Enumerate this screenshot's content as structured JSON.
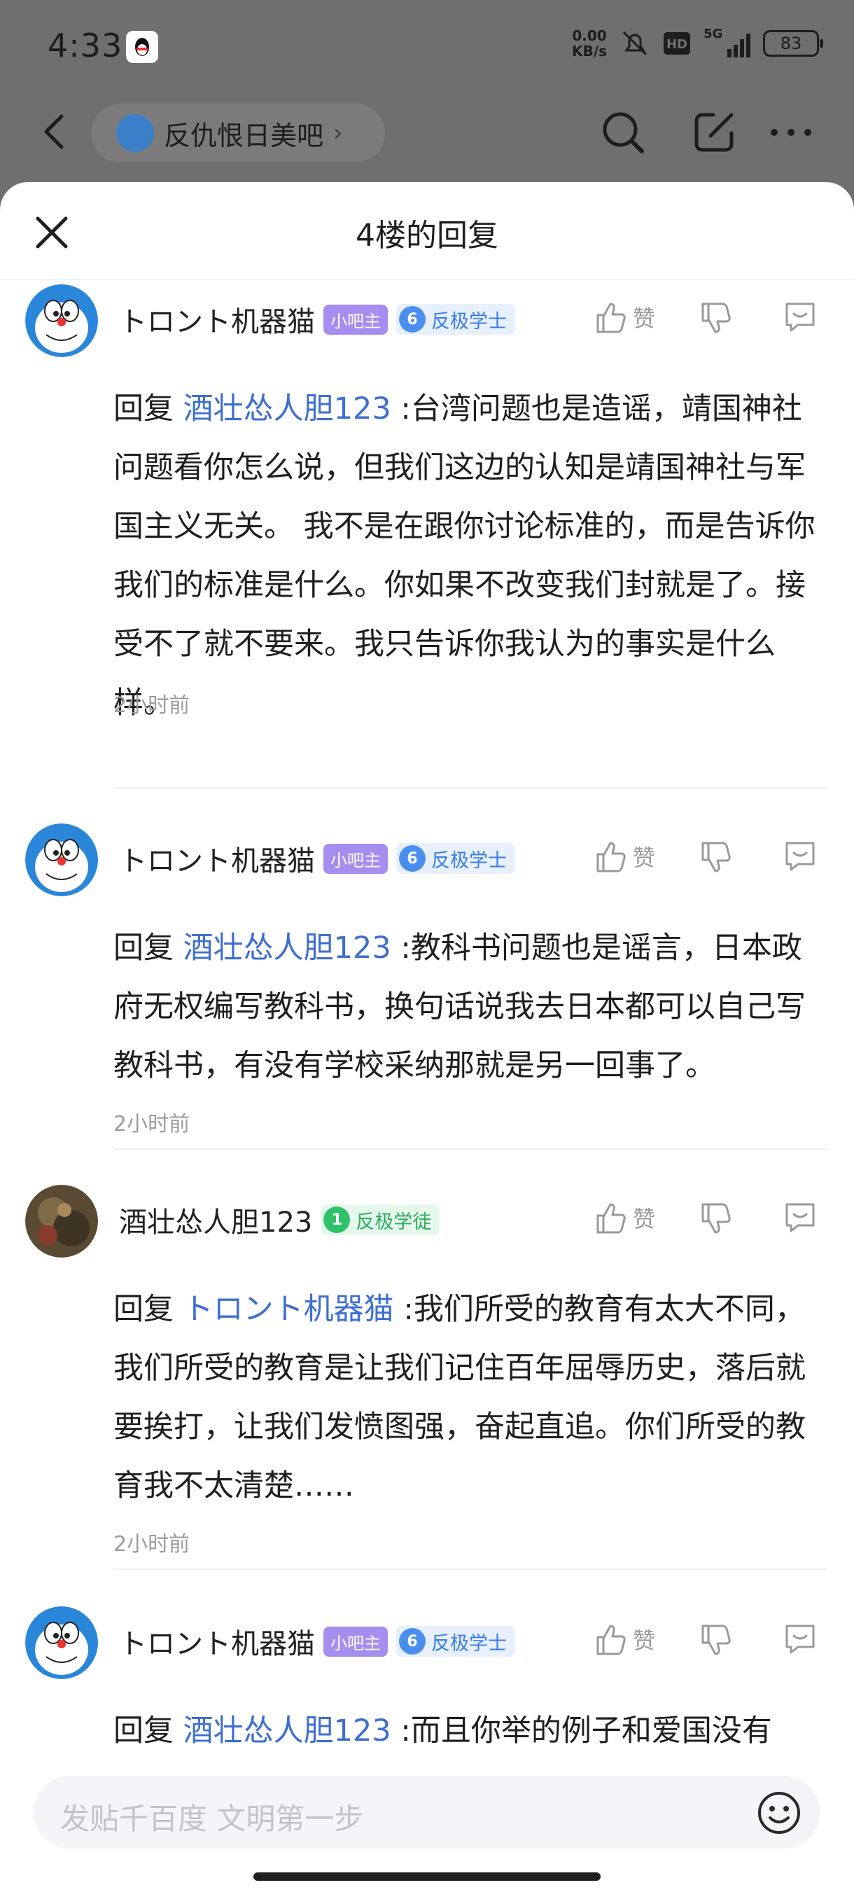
{
  "status_bar": {
    "time": "4:33",
    "net_speed_value": "0.00",
    "net_speed_unit": "KB/s",
    "network": "5G",
    "battery": "83"
  },
  "nav": {
    "forum_name": "反仇恨日美吧",
    "chevron": "›"
  },
  "sheet": {
    "title": "4楼的回复"
  },
  "replies": [
    {
      "username": "トロント机器猫",
      "mod_badge": "小吧主",
      "level": "6",
      "level_title": "反极学士",
      "like_label": "赞",
      "prefix": "回复 ",
      "target": "酒壮怂人胆123",
      "text": " :台湾问题也是造谣，靖国神社问题看你怎么说，但我们这边的认知是靖国神社与军国主义无关。 我不是在跟你讨论标准的，而是告诉你我们的标准是什么。你如果不改变我们封就是了。接受不了就不要来。我只告诉你我认为的事实是什么样。",
      "time": "2小时前"
    },
    {
      "username": "トロント机器猫",
      "mod_badge": "小吧主",
      "level": "6",
      "level_title": "反极学士",
      "like_label": "赞",
      "prefix": "回复 ",
      "target": "酒壮怂人胆123",
      "text": " :教科书问题也是谣言，日本政府无权编写教科书，换句话说我去日本都可以自己写教科书，有没有学校采纳那就是另一回事了。",
      "time": "2小时前"
    },
    {
      "username": "酒壮怂人胆123",
      "level": "1",
      "level_title": "反极学徒",
      "like_label": "赞",
      "prefix": "回复 ",
      "target": "トロント机器猫",
      "text": " :我们所受的教育有太大不同，我们所受的教育是让我们记住百年屈辱历史，落后就要挨打，让我们发愤图强，奋起直追。你们所受的教育我不太清楚……",
      "time": "2小时前"
    },
    {
      "username": "トロント机器猫",
      "mod_badge": "小吧主",
      "level": "6",
      "level_title": "反极学士",
      "like_label": "赞",
      "prefix": "回复 ",
      "target": "酒壮怂人胆123",
      "text": " :而且你举的例子和爱国没有"
    }
  ],
  "input": {
    "placeholder": "发贴千百度 文明第一步"
  },
  "colors": {
    "link": "#3e6fcf",
    "mod_badge": "#a58ef0",
    "level_blue": "#4a8ff0",
    "level_green": "#2fc26a"
  }
}
